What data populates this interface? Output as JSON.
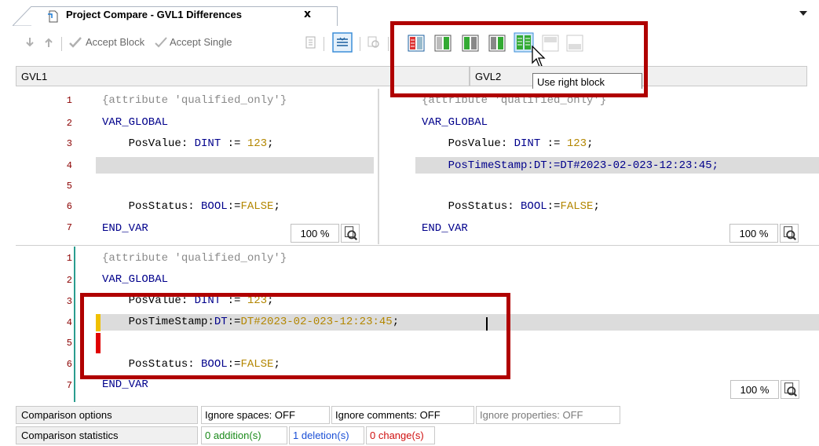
{
  "tab": {
    "title": "Project Compare - GVL1 Differences",
    "close": "x"
  },
  "toolbar": {
    "accept_block": "Accept Block",
    "accept_single": "Accept Single",
    "icons": [
      "arrow-down-icon",
      "arrow-up-icon",
      "accept-block-icon",
      "accept-single-icon",
      "doc-icon",
      "toggle-inline-icon",
      "find-icon",
      "use-left-block-icon",
      "use-left-icon",
      "use-right-icon",
      "use-both-icon",
      "use-right-block-icon",
      "disabled-icon-1",
      "disabled-icon-2"
    ]
  },
  "paths": {
    "left": "GVL1",
    "right": "GVL2"
  },
  "tooltip": "Use right block",
  "left_pane": {
    "line_numbers": [
      "1",
      "2",
      "3",
      "4",
      "5",
      "6",
      "7"
    ],
    "lines": {
      "l1": "{attribute 'qualified_only'}",
      "l2": "VAR_GLOBAL",
      "l3a": "    PosValue: ",
      "l3b": "DINT",
      "l3c": " := ",
      "l3d": "123",
      "l3e": ";",
      "l6a": "    PosStatus: ",
      "l6b": "BOOL",
      "l6c": ":=",
      "l6d": "FALSE",
      "l6e": ";",
      "l7": "END_VAR"
    },
    "zoom": "100 %"
  },
  "right_pane": {
    "lines": {
      "l1": "{attribute 'qualified_only'}",
      "l2": "VAR_GLOBAL",
      "l3a": "    PosValue: ",
      "l3b": "DINT",
      "l3c": " := ",
      "l3d": "123",
      "l3e": ";",
      "l4": "    PosTimeStamp:DT:=DT#2023-02-023-12:23:45;",
      "l6a": "    PosStatus: ",
      "l6b": "BOOL",
      "l6c": ":=",
      "l6d": "FALSE",
      "l6e": ";",
      "l7": "END_VAR"
    },
    "zoom": "100 %"
  },
  "merged_pane": {
    "line_numbers": [
      "1",
      "2",
      "3",
      "4",
      "5",
      "6",
      "7"
    ],
    "lines": {
      "l1": "{attribute 'qualified_only'}",
      "l2": "VAR_GLOBAL",
      "l3a": "    PosValue: ",
      "l3b": "DINT",
      "l3c": " := ",
      "l3d": "123",
      "l3e": ";",
      "l4a": "    PosTimeStamp:",
      "l4b": "DT",
      "l4c": ":=",
      "l4d": "DT#2023-02-023-12:23:45",
      "l4e": ";",
      "l6a": "    PosStatus: ",
      "l6b": "BOOL",
      "l6c": ":=",
      "l6d": "FALSE",
      "l6e": ";",
      "l7": "END_VAR"
    },
    "zoom": "100 %"
  },
  "status": {
    "options_label": "Comparison options",
    "ignore_spaces": "Ignore spaces: OFF",
    "ignore_comments": "Ignore comments: OFF",
    "ignore_properties": "Ignore properties: OFF",
    "statistics_label": "Comparison statistics",
    "additions": "0 addition(s)",
    "deletions": "1 deletion(s)",
    "changes": "0 change(s)"
  },
  "colors": {
    "highlight_red": "#b00000",
    "keyword": "#00008b",
    "number": "#b38600",
    "comment": "#8a8a8a",
    "diff_bg": "#dcdcdc"
  }
}
